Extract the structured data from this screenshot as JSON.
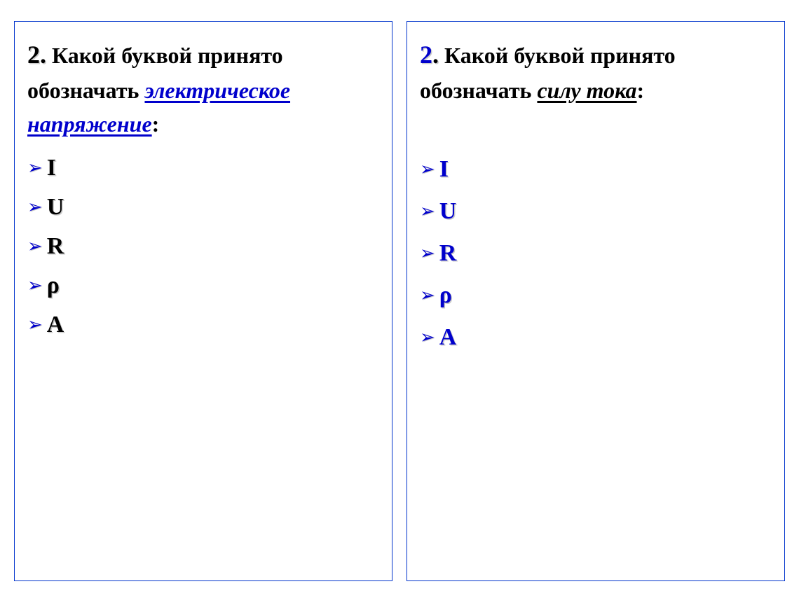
{
  "left_panel": {
    "number": "2.",
    "question_prefix": " Какой буквой принято обозначать ",
    "term": "электрическое напряжение",
    "question_suffix": ":",
    "options": [
      "I",
      "U",
      "R",
      "ρ",
      "A"
    ]
  },
  "right_panel": {
    "number": "2",
    "number_dot": ".",
    "question_prefix": " Какой буквой принято обозначать ",
    "term": "силу тока",
    "question_suffix": ":",
    "options": [
      "I",
      "U",
      "R",
      "ρ",
      "A"
    ]
  },
  "bullet_char": "➢"
}
